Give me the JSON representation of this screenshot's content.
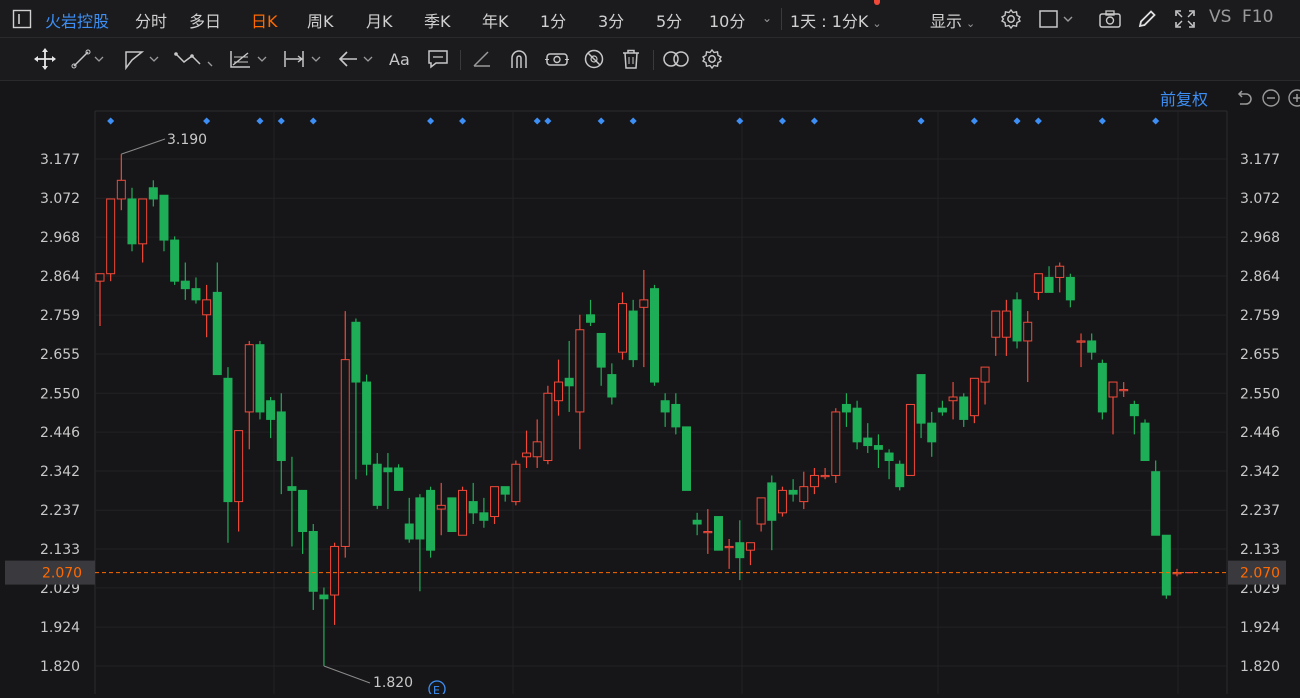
{
  "header": {
    "stock_name": "火岩控股",
    "tabs": [
      "分时",
      "多日",
      "日K",
      "周K",
      "月K",
      "季K",
      "年K",
      "1分",
      "3分",
      "5分",
      "10分"
    ],
    "active_tab": "日K",
    "interval_select": "1天 : 1分K",
    "display_label": "显示",
    "vs_label": "VS",
    "f10_label": "F10"
  },
  "adjust_label": "前复权",
  "colors": {
    "up": "#f0493a",
    "down": "#1fae58",
    "accent": "#3d8ff5",
    "current": "#ff6a00",
    "bg": "#161618"
  },
  "icons": [
    "cursor-icon",
    "sidebar-toggle-icon",
    "line-tool-icon",
    "ray-tool-icon",
    "polyline-tool-icon",
    "fib-tool-icon",
    "measure-tool-icon",
    "arrow-tool-icon",
    "text-tool-icon",
    "comment-tool-icon",
    "ruler-tool-icon",
    "magnet-icon",
    "lock-icon",
    "hide-icon",
    "trash-icon",
    "compare-icon",
    "settings-icon",
    "camera-icon",
    "pencil-icon",
    "fullscreen-icon",
    "undo-icon",
    "zoom-out-icon",
    "zoom-in-icon"
  ],
  "chart_data": {
    "type": "candlestick",
    "y_ticks": [
      "3.177",
      "3.072",
      "2.968",
      "2.864",
      "2.759",
      "2.655",
      "2.550",
      "2.446",
      "2.342",
      "2.237",
      "2.133",
      "2.029",
      "1.924",
      "1.820"
    ],
    "ylim": [
      1.77,
      3.31
    ],
    "current_price": "2.070",
    "max_label": "3.190",
    "min_label": "1.820",
    "event_marker": "E",
    "candles": [
      [
        2.85,
        2.87,
        2.73,
        2.87
      ],
      [
        2.87,
        3.07,
        2.85,
        3.07
      ],
      [
        3.07,
        3.19,
        3.04,
        3.12
      ],
      [
        3.07,
        3.1,
        2.93,
        2.95
      ],
      [
        2.95,
        3.07,
        2.9,
        3.07
      ],
      [
        3.1,
        3.12,
        3.05,
        3.07
      ],
      [
        3.08,
        3.08,
        2.93,
        2.96
      ],
      [
        2.96,
        2.97,
        2.84,
        2.85
      ],
      [
        2.85,
        2.9,
        2.8,
        2.83
      ],
      [
        2.83,
        2.86,
        2.79,
        2.8
      ],
      [
        2.76,
        2.84,
        2.7,
        2.8
      ],
      [
        2.82,
        2.9,
        2.6,
        2.6
      ],
      [
        2.59,
        2.62,
        2.15,
        2.26
      ],
      [
        2.26,
        2.27,
        2.18,
        2.45
      ],
      [
        2.5,
        2.69,
        2.4,
        2.68
      ],
      [
        2.68,
        2.69,
        2.48,
        2.5
      ],
      [
        2.53,
        2.54,
        2.43,
        2.48
      ],
      [
        2.5,
        2.55,
        2.28,
        2.37
      ],
      [
        2.3,
        2.38,
        2.14,
        2.29
      ],
      [
        2.29,
        2.29,
        2.12,
        2.18
      ],
      [
        2.18,
        2.2,
        1.97,
        2.02
      ],
      [
        2.01,
        2.03,
        1.82,
        2
      ],
      [
        2.01,
        2.15,
        1.93,
        2.14
      ],
      [
        2.14,
        2.77,
        2.11,
        2.64
      ],
      [
        2.74,
        2.75,
        2.32,
        2.58
      ],
      [
        2.58,
        2.6,
        2.33,
        2.36
      ],
      [
        2.36,
        2.39,
        2.24,
        2.25
      ],
      [
        2.35,
        2.39,
        2.24,
        2.34
      ],
      [
        2.35,
        2.36,
        2.29,
        2.29
      ],
      [
        2.2,
        2.27,
        2.15,
        2.16
      ],
      [
        2.27,
        2.28,
        2.02,
        2.16
      ],
      [
        2.29,
        2.3,
        2.11,
        2.13
      ],
      [
        2.24,
        2.31,
        2.17,
        2.25
      ],
      [
        2.27,
        2.27,
        2.19,
        2.18
      ],
      [
        2.17,
        2.3,
        2.17,
        2.29
      ],
      [
        2.26,
        2.31,
        2.2,
        2.23
      ],
      [
        2.23,
        2.27,
        2.19,
        2.21
      ],
      [
        2.22,
        2.3,
        2.2,
        2.3
      ],
      [
        2.3,
        2.29,
        2.26,
        2.28
      ],
      [
        2.26,
        2.37,
        2.25,
        2.36
      ],
      [
        2.38,
        2.45,
        2.35,
        2.39
      ],
      [
        2.38,
        2.48,
        2.35,
        2.42
      ],
      [
        2.37,
        2.57,
        2.36,
        2.55
      ],
      [
        2.53,
        2.64,
        2.49,
        2.58
      ],
      [
        2.59,
        2.69,
        2.5,
        2.57
      ],
      [
        2.5,
        2.76,
        2.4,
        2.72
      ],
      [
        2.76,
        2.8,
        2.73,
        2.74
      ],
      [
        2.71,
        2.71,
        2.57,
        2.62
      ],
      [
        2.6,
        2.63,
        2.52,
        2.54
      ],
      [
        2.66,
        2.82,
        2.64,
        2.79
      ],
      [
        2.77,
        2.8,
        2.62,
        2.64
      ],
      [
        2.78,
        2.88,
        2.62,
        2.8
      ],
      [
        2.83,
        2.84,
        2.57,
        2.58
      ],
      [
        2.53,
        2.55,
        2.46,
        2.5
      ],
      [
        2.52,
        2.55,
        2.44,
        2.46
      ],
      [
        2.46,
        2.46,
        2.29,
        2.29
      ],
      [
        2.21,
        2.23,
        2.17,
        2.2
      ],
      [
        2.18,
        2.24,
        2.12,
        2.18
      ],
      [
        2.22,
        2.22,
        2.14,
        2.13
      ],
      [
        2.14,
        2.16,
        2.08,
        2.14
      ],
      [
        2.15,
        2.21,
        2.05,
        2.11
      ],
      [
        2.13,
        2.15,
        2.09,
        2.15
      ],
      [
        2.2,
        2.27,
        2.18,
        2.27
      ],
      [
        2.31,
        2.33,
        2.13,
        2.21
      ],
      [
        2.23,
        2.3,
        2.22,
        2.29
      ],
      [
        2.29,
        2.32,
        2.26,
        2.28
      ],
      [
        2.26,
        2.34,
        2.24,
        2.3
      ],
      [
        2.3,
        2.35,
        2.28,
        2.33
      ],
      [
        2.33,
        2.35,
        2.32,
        2.33
      ],
      [
        2.33,
        2.51,
        2.31,
        2.5
      ],
      [
        2.52,
        2.55,
        2.46,
        2.5
      ],
      [
        2.51,
        2.53,
        2.4,
        2.42
      ],
      [
        2.43,
        2.47,
        2.39,
        2.41
      ],
      [
        2.41,
        2.44,
        2.35,
        2.4
      ],
      [
        2.39,
        2.4,
        2.32,
        2.37
      ],
      [
        2.36,
        2.37,
        2.29,
        2.3
      ],
      [
        2.33,
        2.52,
        2.33,
        2.52
      ],
      [
        2.6,
        2.6,
        2.43,
        2.47
      ],
      [
        2.47,
        2.5,
        2.38,
        2.42
      ],
      [
        2.51,
        2.53,
        2.49,
        2.5
      ],
      [
        2.53,
        2.58,
        2.48,
        2.54
      ],
      [
        2.54,
        2.55,
        2.46,
        2.48
      ],
      [
        2.49,
        2.53,
        2.47,
        2.59
      ],
      [
        2.58,
        2.62,
        2.52,
        2.62
      ],
      [
        2.7,
        2.77,
        2.65,
        2.77
      ],
      [
        2.7,
        2.8,
        2.65,
        2.77
      ],
      [
        2.8,
        2.82,
        2.67,
        2.69
      ],
      [
        2.69,
        2.77,
        2.58,
        2.74
      ],
      [
        2.82,
        2.85,
        2.8,
        2.87
      ],
      [
        2.86,
        2.89,
        2.84,
        2.82
      ],
      [
        2.86,
        2.9,
        2.82,
        2.89
      ],
      [
        2.86,
        2.87,
        2.78,
        2.8
      ],
      [
        2.69,
        2.71,
        2.62,
        2.69
      ],
      [
        2.69,
        2.71,
        2.64,
        2.66
      ],
      [
        2.63,
        2.64,
        2.48,
        2.5
      ],
      [
        2.54,
        2.55,
        2.44,
        2.58
      ],
      [
        2.56,
        2.58,
        2.54,
        2.56
      ],
      [
        2.52,
        2.53,
        2.44,
        2.49
      ],
      [
        2.47,
        2.48,
        2.38,
        2.37
      ],
      [
        2.34,
        2.37,
        2.25,
        2.17
      ],
      [
        2.17,
        2.17,
        2.0,
        2.01
      ],
      [
        2.07,
        2.08,
        2.06,
        2.07
      ]
    ],
    "event_marks": 20
  }
}
